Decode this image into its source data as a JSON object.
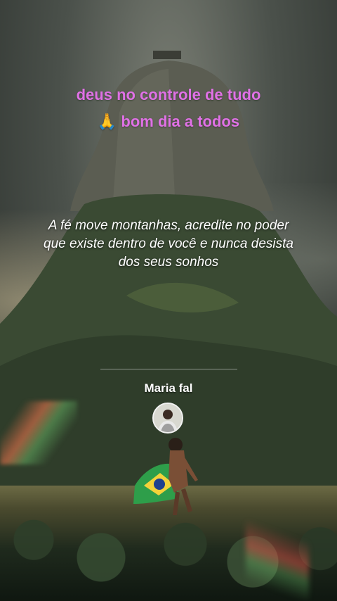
{
  "post": {
    "caption": "deus no controle de tudo 🙏 bom dia a todos",
    "quote": "A fé move montanhas, acredite no poder que existe dentro de você e nunca desista dos seus sonhos",
    "author_name": "Maria fal"
  },
  "background": {
    "scene": "mountain-with-girl-and-brazil-flag",
    "flag_colors": [
      "#2e9e4a",
      "#f3d23a",
      "#1f3f8f"
    ]
  }
}
